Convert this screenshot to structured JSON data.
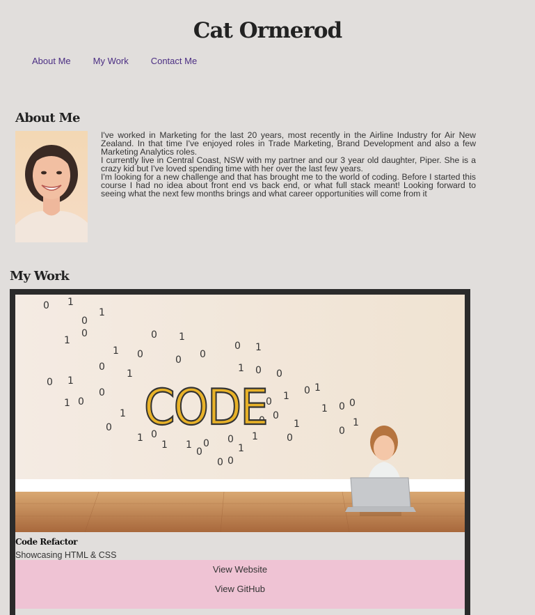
{
  "site": {
    "title": "Cat Ormerod"
  },
  "nav": {
    "items": [
      {
        "label": "About Me"
      },
      {
        "label": "My Work"
      },
      {
        "label": "Contact Me"
      }
    ]
  },
  "about": {
    "heading": "About Me",
    "paragraphs": [
      "I've worked in Marketing for the last 20 years, most recently in the Airline Industry for Air New Zealand. In that time I've enjoyed roles in Trade Marketing, Brand Development and also a few Marketing Analytics roles.",
      "I currently live in Central Coast, NSW with my partner and our 3 year old daughter, Piper. She is a crazy kid but I've loved spending time with her over the last few years.",
      "I'm looking for a new challenge and that has brought me to the world of coding. Before I started this course I had no idea about front end vs back end, or what full stack meant! Looking forward to seeing what the next few months brings and what career opportunities will come from it"
    ]
  },
  "work": {
    "heading": "My Work",
    "projects": [
      {
        "title": "Code Refactor",
        "description": "Showcasing HTML & CSS",
        "image_word": "CODE",
        "website_label": "View Website",
        "github_label": "View GitHub"
      }
    ]
  },
  "colors": {
    "background": "#e1dedc",
    "nav_link": "#4b2e83",
    "card_border": "#2b2b2b",
    "link_panel": "#efc3d4",
    "code_letters": "#e8b228"
  }
}
